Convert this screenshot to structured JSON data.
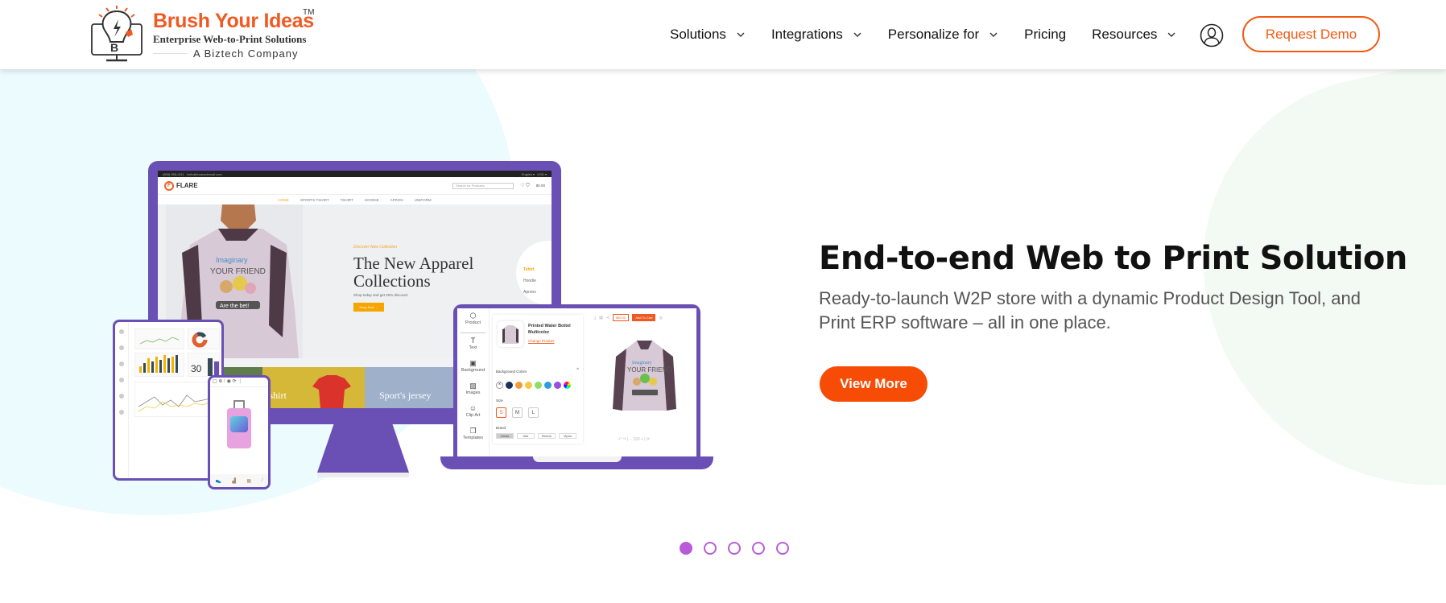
{
  "header": {
    "logo": {
      "title": "Brush Your Ideas",
      "trademark": "TM",
      "subtitle": "Enterprise Web-to-Print Solutions",
      "company": "A Biztech Company"
    },
    "nav": [
      {
        "label": "Solutions",
        "has_dropdown": true
      },
      {
        "label": "Integrations",
        "has_dropdown": true
      },
      {
        "label": "Personalize for",
        "has_dropdown": true
      },
      {
        "label": "Pricing",
        "has_dropdown": false
      },
      {
        "label": "Resources",
        "has_dropdown": true
      }
    ],
    "user_icon": "user-account-icon",
    "cta": "Request Demo"
  },
  "hero": {
    "title": "End-to-end Web to Print Solution",
    "description": "Ready-to-launch W2P store with a dynamic Product Design Tool, and Print ERP software – all in one place.",
    "button": "View More"
  },
  "carousel": {
    "total_slides": 5,
    "active_index": 0
  },
  "illustration": {
    "monitor": {
      "topbar_phone": "(808) 555-0111",
      "topbar_email": "hello@examplemail.com",
      "topbar_lang": "English ▾",
      "topbar_currency": "USD ▾",
      "brand": "FLARE",
      "search_placeholder": "Search for Products",
      "cart_total": "$0.00",
      "menu": [
        "HOME",
        "SPORTS TSHIRT",
        "TSHIRT",
        "HOODIE",
        "APRON",
        "UNIFORM"
      ],
      "discover": "Discover New Collection",
      "headline": "The New Apparel Collections",
      "shop_text": "Shop today and get 20% discount",
      "shop_button": "Shop Now →",
      "circle_menu": [
        "Tshirt",
        "Hoodie",
        "Aprons"
      ],
      "tiles": [
        "Tshirt",
        "Sport's jersey"
      ],
      "hoodie_print": [
        "Imaginary",
        "YOUR FRIEND",
        "Are the bet!"
      ]
    },
    "dashboard": {
      "stat_value": "30"
    },
    "laptop": {
      "tools": [
        "Product",
        "Text",
        "Background",
        "Images",
        "Clip Art",
        "Templates"
      ],
      "product_name": "Printed Water Bottel Multicolor",
      "change_product": "Change Product",
      "background_colors_label": "Background Colors",
      "swatches": [
        "#ffffff",
        "#1f2f5c",
        "#f39a3c",
        "#f5c842",
        "#8edc6a",
        "#2d9ee0",
        "#9a4fe0",
        "rainbow"
      ],
      "size_label": "Size",
      "sizes": [
        "S",
        "M",
        "L"
      ],
      "selected_size": "S",
      "brand_label": "Brand",
      "brands": [
        "Adidas",
        "Nike",
        "Reebok",
        "Mynta"
      ],
      "selected_brand": "Adidas",
      "price": "$50.00",
      "add_to_cart": "Add To Cart"
    }
  },
  "colors": {
    "brand_orange": "#f05a22",
    "cta_orange": "#f74c05",
    "device_purple": "#6a4fb5",
    "dot_purple": "#b85ad9",
    "bg_cyan": "#ebfbfe",
    "bg_green": "#f3faf3"
  }
}
